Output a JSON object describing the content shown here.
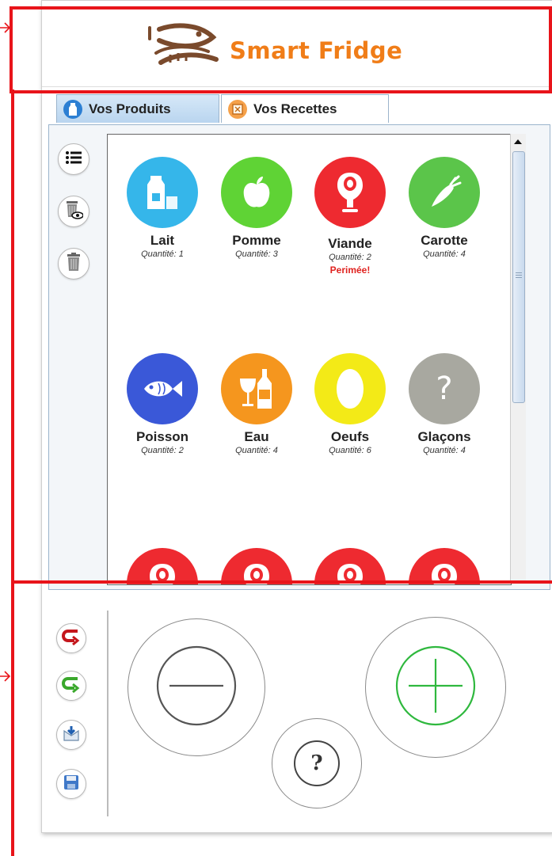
{
  "app": {
    "title": "Smart Fridge",
    "brand_color": "#f07d18"
  },
  "tabs": [
    {
      "label": "Vos Produits",
      "icon": "milk-icon",
      "active": true
    },
    {
      "label": "Vos Recettes",
      "icon": "recipe-icon",
      "active": false
    }
  ],
  "sidebar_tools": [
    {
      "name": "list-view-button",
      "icon": "list-icon"
    },
    {
      "name": "show-deleted-button",
      "icon": "trash-eye-icon"
    },
    {
      "name": "delete-button",
      "icon": "trash-icon"
    }
  ],
  "products": [
    {
      "name": "Lait",
      "quantity": "Quantité: 1",
      "icon": "milk-icon",
      "color": "#35b6ea",
      "status": ""
    },
    {
      "name": "Pomme",
      "quantity": "Quantité: 3",
      "icon": "apple-icon",
      "color": "#5fd335",
      "status": ""
    },
    {
      "name": "Viande",
      "quantity": "Quantité: 2",
      "icon": "meat-icon",
      "color": "#ee2a30",
      "status": "Perimée!"
    },
    {
      "name": "Carotte",
      "quantity": "Quantité: 4",
      "icon": "carrot-icon",
      "color": "#5bc54a",
      "status": ""
    },
    {
      "name": "Poisson",
      "quantity": "Quantité: 2",
      "icon": "fish-icon",
      "color": "#3a58d8",
      "status": ""
    },
    {
      "name": "Eau",
      "quantity": "Quantité: 4",
      "icon": "drinks-icon",
      "color": "#f5961e",
      "status": ""
    },
    {
      "name": "Oeufs",
      "quantity": "Quantité: 6",
      "icon": "egg-icon",
      "color": "#f3ea17",
      "status": ""
    },
    {
      "name": "Glaçons",
      "quantity": "Quantité: 4",
      "icon": "question-icon",
      "color": "#a8a8a0",
      "status": ""
    }
  ],
  "bottom_tools": [
    {
      "name": "undo-button",
      "icon": "undo-icon"
    },
    {
      "name": "redo-button",
      "icon": "redo-icon"
    },
    {
      "name": "export-button",
      "icon": "export-icon"
    },
    {
      "name": "save-button",
      "icon": "save-icon"
    }
  ],
  "controls": {
    "minus": "minus-icon",
    "plus": "plus-icon",
    "help": "?"
  },
  "annotations": {
    "color": "#e8141a"
  }
}
